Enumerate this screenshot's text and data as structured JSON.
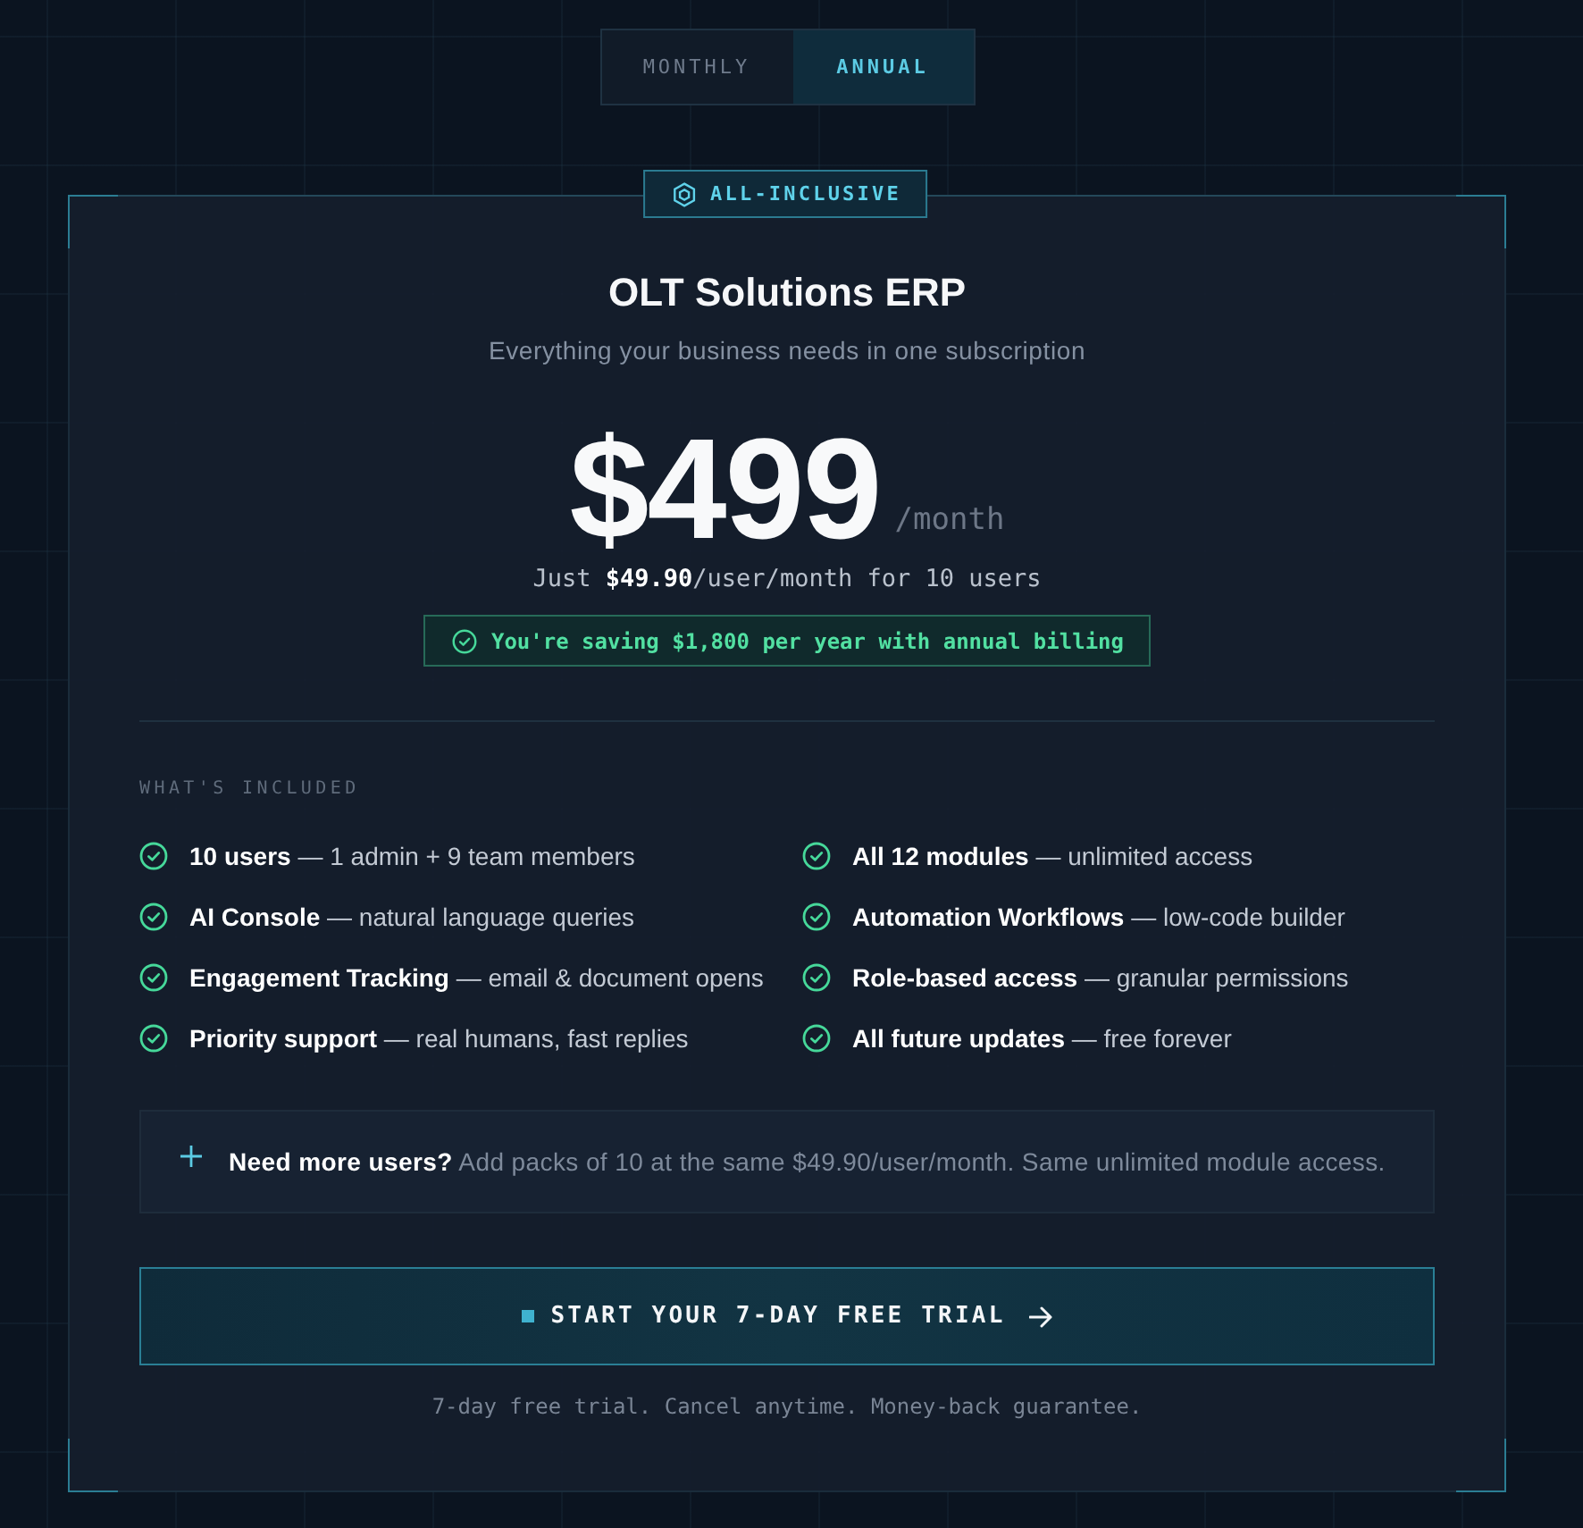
{
  "billing_toggle": [
    {
      "label": "MONTHLY",
      "selected": false
    },
    {
      "label": "ANNUAL",
      "selected": true
    }
  ],
  "plan": {
    "badge": "ALL-INCLUSIVE",
    "title": "OLT Solutions ERP",
    "subtitle": "Everything your business needs in one subscription",
    "price": "$499",
    "period": "/month",
    "per_user_note": "Just **$49.90**/user/month for 10 users",
    "savings": "You're saving $1,800 per year with annual billing"
  },
  "included": {
    "heading": "WHAT'S INCLUDED",
    "features": [
      {
        "text": "**10 users** — 1 admin + 9 team members"
      },
      {
        "text": "**All 12 modules** — unlimited access"
      },
      {
        "text": "**AI Console** — natural language queries"
      },
      {
        "text": "**Automation Workflows** — low-code builder"
      },
      {
        "text": "**Engagement Tracking** — email & document opens"
      },
      {
        "text": "**Role-based access** — granular permissions"
      },
      {
        "text": "**Priority support** — real humans, fast replies"
      },
      {
        "text": "**All future updates** — free forever"
      }
    ]
  },
  "addon": {
    "text": "**Need more users?** Add packs of 10 at the same $49.90/user/month. Same unlimited module access."
  },
  "cta": {
    "label": "START YOUR 7-DAY FREE TRIAL"
  },
  "footnote": "7-day free trial. Cancel anytime. Money-back guarantee."
}
